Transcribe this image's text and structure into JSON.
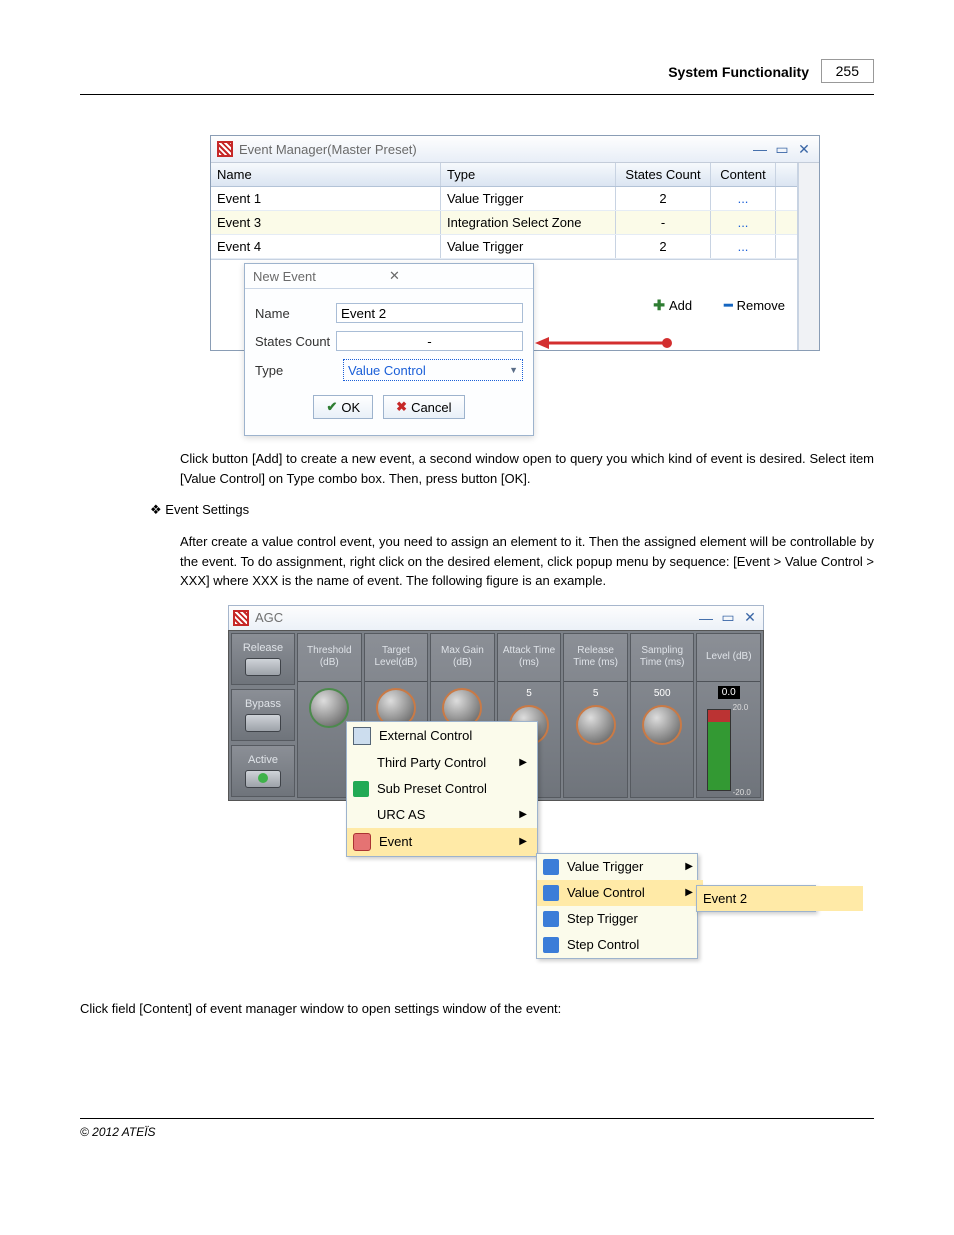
{
  "header": {
    "title": "System Functionality",
    "page": "255"
  },
  "event_manager": {
    "title": "Event Manager(Master Preset)",
    "columns": {
      "name": "Name",
      "type": "Type",
      "states": "States Count",
      "content": "Content"
    },
    "rows": [
      {
        "name": "Event 1",
        "type": "Value Trigger",
        "states": "2",
        "content": "..."
      },
      {
        "name": "Event 3",
        "type": "Integration Select Zone",
        "states": "-",
        "content": "..."
      },
      {
        "name": "Event 4",
        "type": "Value Trigger",
        "states": "2",
        "content": "..."
      }
    ],
    "add": "Add",
    "remove": "Remove"
  },
  "new_event": {
    "title": "New Event",
    "name_label": "Name",
    "name_value": "Event 2",
    "states_label": "States Count",
    "states_value": "-",
    "type_label": "Type",
    "type_value": "Value Control",
    "ok": "OK",
    "cancel": "Cancel"
  },
  "text": {
    "p1": "Click button [Add] to create a new event, a second window open to query you which kind of event is desired. Select item [Value Control] on Type combo box. Then, press button [OK].",
    "h2": "Event Settings",
    "p2": "After create a value control event, you need to assign an element to it. Then the assigned element will be controllable by the event. To do assignment, right click on the desired element, click popup menu by sequence: [Event > Value Control > XXX] where XXX is the name of event. The following figure is an example.",
    "p3": "Click field [Content] of event manager window to open settings window of the event:"
  },
  "agc": {
    "title": "AGC",
    "sidebar": [
      "Release",
      "Bypass",
      "Active"
    ],
    "columns": [
      "Threshold (dB)",
      "Target Level(dB)",
      "Max Gain (dB)",
      "Attack Time (ms)",
      "Release Time (ms)",
      "Sampling Time (ms)",
      "Level (dB)"
    ],
    "sample_vals": {
      "attack": "5",
      "release": "5",
      "sampling": "500",
      "level": "0.0",
      "scale_hi": "20.0",
      "scale_lo": "-20.0"
    }
  },
  "ctx1": [
    {
      "label": "External Control",
      "arrow": false
    },
    {
      "label": "Third Party Control",
      "arrow": true
    },
    {
      "label": "Sub Preset Control",
      "arrow": false
    },
    {
      "label": "URC AS",
      "arrow": true
    },
    {
      "label": "Event",
      "arrow": true
    }
  ],
  "ctx2": [
    {
      "label": "Value Trigger",
      "arrow": true
    },
    {
      "label": "Value Control",
      "arrow": true
    },
    {
      "label": "Step Trigger",
      "arrow": false
    },
    {
      "label": "Step Control",
      "arrow": false
    }
  ],
  "ctx3": [
    {
      "label": "Event 2",
      "arrow": false
    }
  ],
  "footer": "© 2012 ATEÏS"
}
